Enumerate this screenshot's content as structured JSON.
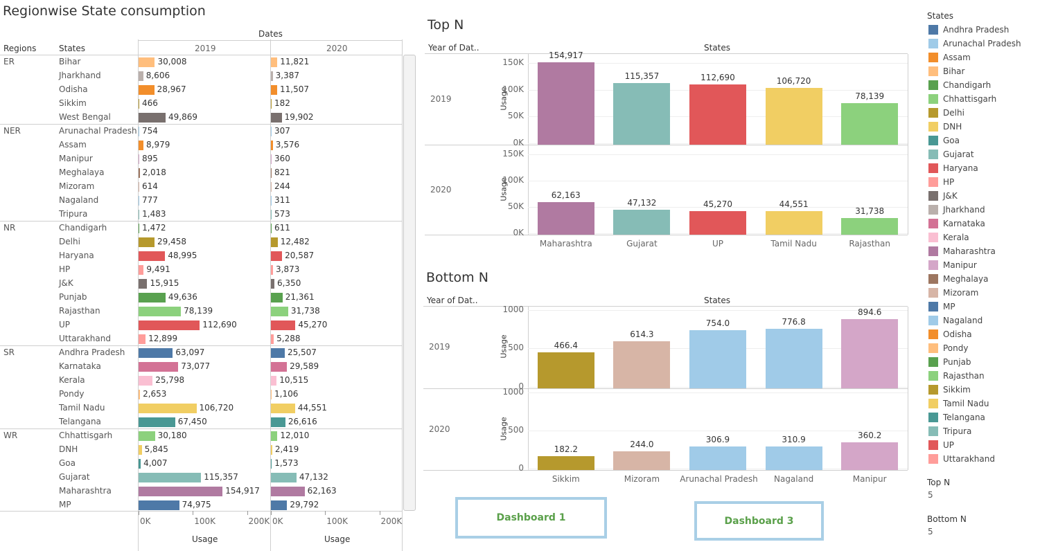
{
  "colors": {
    "Andhra Pradesh": "#4e79a7",
    "Arunachal Pradesh": "#a0cbe8",
    "Assam": "#f28e2b",
    "Bihar": "#ffbe7d",
    "Chandigarh": "#59a14f",
    "Chhattisgarh": "#8cd17d",
    "Delhi": "#b6992d",
    "DNH": "#f1ce63",
    "Goa": "#499894",
    "Gujarat": "#86bcb6",
    "Haryana": "#e15759",
    "HP": "#ff9d9a",
    "J&K": "#79706e",
    "Jharkhand": "#bab0ac",
    "Karnataka": "#d37295",
    "Kerala": "#fabfd2",
    "Maharashtra": "#b07aa1",
    "Manipur": "#d4a6c8",
    "Meghalaya": "#9d7660",
    "Mizoram": "#d7b5a6",
    "MP": "#4e79a7",
    "Nagaland": "#a0cbe8",
    "Odisha": "#f28e2b",
    "Pondy": "#ffbe7d",
    "Punjab": "#59a14f",
    "Rajasthan": "#8cd17d",
    "Sikkim": "#b6992d",
    "Tamil Nadu": "#f1ce63",
    "Telangana": "#499894",
    "Tripura": "#86bcb6",
    "UP": "#e15759",
    "Uttarakhand": "#ff9d9a",
    "West Bengal": "#79706e"
  },
  "left": {
    "title": "Regionwise State consumption",
    "dates_header": "Dates",
    "regions_header": "Regions",
    "states_header": "States",
    "col_2019": "2019",
    "col_2020": "2020",
    "axis_ticks": [
      "0K",
      "100K",
      "200K"
    ],
    "axis_title": "Usage",
    "rows": [
      {
        "region": "ER",
        "state": "Bihar",
        "v2019": 30008,
        "l2019": "30,008",
        "v2020": 11821,
        "l2020": "11,821"
      },
      {
        "region": "",
        "state": "Jharkhand",
        "v2019": 8606,
        "l2019": "8,606",
        "v2020": 3387,
        "l2020": "3,387"
      },
      {
        "region": "",
        "state": "Odisha",
        "v2019": 28967,
        "l2019": "28,967",
        "v2020": 11507,
        "l2020": "11,507"
      },
      {
        "region": "",
        "state": "Sikkim",
        "v2019": 466,
        "l2019": "466",
        "v2020": 182,
        "l2020": "182"
      },
      {
        "region": "",
        "state": "West Bengal",
        "v2019": 49869,
        "l2019": "49,869",
        "v2020": 19902,
        "l2020": "19,902"
      },
      {
        "region": "NER",
        "state": "Arunachal Pradesh",
        "v2019": 754,
        "l2019": "754",
        "v2020": 307,
        "l2020": "307"
      },
      {
        "region": "",
        "state": "Assam",
        "v2019": 8979,
        "l2019": "8,979",
        "v2020": 3576,
        "l2020": "3,576"
      },
      {
        "region": "",
        "state": "Manipur",
        "v2019": 895,
        "l2019": "895",
        "v2020": 360,
        "l2020": "360"
      },
      {
        "region": "",
        "state": "Meghalaya",
        "v2019": 2018,
        "l2019": "2,018",
        "v2020": 821,
        "l2020": "821"
      },
      {
        "region": "",
        "state": "Mizoram",
        "v2019": 614,
        "l2019": "614",
        "v2020": 244,
        "l2020": "244"
      },
      {
        "region": "",
        "state": "Nagaland",
        "v2019": 777,
        "l2019": "777",
        "v2020": 311,
        "l2020": "311"
      },
      {
        "region": "",
        "state": "Tripura",
        "v2019": 1483,
        "l2019": "1,483",
        "v2020": 573,
        "l2020": "573"
      },
      {
        "region": "NR",
        "state": "Chandigarh",
        "v2019": 1472,
        "l2019": "1,472",
        "v2020": 611,
        "l2020": "611"
      },
      {
        "region": "",
        "state": "Delhi",
        "v2019": 29458,
        "l2019": "29,458",
        "v2020": 12482,
        "l2020": "12,482"
      },
      {
        "region": "",
        "state": "Haryana",
        "v2019": 48995,
        "l2019": "48,995",
        "v2020": 20587,
        "l2020": "20,587"
      },
      {
        "region": "",
        "state": "HP",
        "v2019": 9491,
        "l2019": "9,491",
        "v2020": 3873,
        "l2020": "3,873"
      },
      {
        "region": "",
        "state": "J&K",
        "v2019": 15915,
        "l2019": "15,915",
        "v2020": 6350,
        "l2020": "6,350"
      },
      {
        "region": "",
        "state": "Punjab",
        "v2019": 49636,
        "l2019": "49,636",
        "v2020": 21361,
        "l2020": "21,361"
      },
      {
        "region": "",
        "state": "Rajasthan",
        "v2019": 78139,
        "l2019": "78,139",
        "v2020": 31738,
        "l2020": "31,738"
      },
      {
        "region": "",
        "state": "UP",
        "v2019": 112690,
        "l2019": "112,690",
        "v2020": 45270,
        "l2020": "45,270"
      },
      {
        "region": "",
        "state": "Uttarakhand",
        "v2019": 12899,
        "l2019": "12,899",
        "v2020": 5288,
        "l2020": "5,288"
      },
      {
        "region": "SR",
        "state": "Andhra Pradesh",
        "v2019": 63097,
        "l2019": "63,097",
        "v2020": 25507,
        "l2020": "25,507"
      },
      {
        "region": "",
        "state": "Karnataka",
        "v2019": 73077,
        "l2019": "73,077",
        "v2020": 29589,
        "l2020": "29,589"
      },
      {
        "region": "",
        "state": "Kerala",
        "v2019": 25798,
        "l2019": "25,798",
        "v2020": 10515,
        "l2020": "10,515"
      },
      {
        "region": "",
        "state": "Pondy",
        "v2019": 2653,
        "l2019": "2,653",
        "v2020": 1106,
        "l2020": "1,106"
      },
      {
        "region": "",
        "state": "Tamil Nadu",
        "v2019": 106720,
        "l2019": "106,720",
        "v2020": 44551,
        "l2020": "44,551"
      },
      {
        "region": "",
        "state": "Telangana",
        "v2019": 67450,
        "l2019": "67,450",
        "v2020": 26616,
        "l2020": "26,616"
      },
      {
        "region": "WR",
        "state": "Chhattisgarh",
        "v2019": 30180,
        "l2019": "30,180",
        "v2020": 12010,
        "l2020": "12,010"
      },
      {
        "region": "",
        "state": "DNH",
        "v2019": 5845,
        "l2019": "5,845",
        "v2020": 2419,
        "l2020": "2,419"
      },
      {
        "region": "",
        "state": "Goa",
        "v2019": 4007,
        "l2019": "4,007",
        "v2020": 1573,
        "l2020": "1,573"
      },
      {
        "region": "",
        "state": "Gujarat",
        "v2019": 115357,
        "l2019": "115,357",
        "v2020": 47132,
        "l2020": "47,132"
      },
      {
        "region": "",
        "state": "Maharashtra",
        "v2019": 154917,
        "l2019": "154,917",
        "v2020": 62163,
        "l2020": "62,163"
      },
      {
        "region": "",
        "state": "MP",
        "v2019": 74975,
        "l2019": "74,975",
        "v2020": 29792,
        "l2020": "29,792"
      }
    ]
  },
  "top_n": {
    "title": "Top N",
    "year_header": "Year of Dat..",
    "states_header": "States",
    "y_title": "Usage",
    "y_ticks": [
      "150K",
      "100K",
      "50K",
      "0K"
    ],
    "years": [
      "2019",
      "2020"
    ],
    "states": [
      "Maharashtra",
      "Gujarat",
      "UP",
      "Tamil Nadu",
      "Rajasthan"
    ],
    "values": [
      [
        154917,
        115357,
        112690,
        106720,
        78139
      ],
      [
        62163,
        47132,
        45270,
        44551,
        31738
      ]
    ],
    "labels": [
      [
        "154,917",
        "115,357",
        "112,690",
        "106,720",
        "78,139"
      ],
      [
        "62,163",
        "47,132",
        "45,270",
        "44,551",
        "31,738"
      ]
    ]
  },
  "bottom_n": {
    "title": "Bottom N",
    "year_header": "Year of Dat..",
    "states_header": "States",
    "y_title": "Usage",
    "y_ticks": [
      "1000",
      "500",
      "0"
    ],
    "years": [
      "2019",
      "2020"
    ],
    "states": [
      "Sikkim",
      "Mizoram",
      "Arunachal Pradesh",
      "Nagaland",
      "Manipur"
    ],
    "values": [
      [
        466.4,
        614.3,
        754.0,
        776.8,
        894.6
      ],
      [
        182.2,
        244.0,
        306.9,
        310.9,
        360.2
      ]
    ],
    "labels": [
      [
        "466.4",
        "614.3",
        "754.0",
        "776.8",
        "894.6"
      ],
      [
        "182.2",
        "244.0",
        "306.9",
        "310.9",
        "360.2"
      ]
    ]
  },
  "chart_data": [
    {
      "type": "bar",
      "title": "Regionwise State consumption",
      "xlabel": "Usage",
      "categories": [
        "Bihar",
        "Jharkhand",
        "Odisha",
        "Sikkim",
        "West Bengal",
        "Arunachal Pradesh",
        "Assam",
        "Manipur",
        "Meghalaya",
        "Mizoram",
        "Nagaland",
        "Tripura",
        "Chandigarh",
        "Delhi",
        "Haryana",
        "HP",
        "J&K",
        "Punjab",
        "Rajasthan",
        "UP",
        "Uttarakhand",
        "Andhra Pradesh",
        "Karnataka",
        "Kerala",
        "Pondy",
        "Tamil Nadu",
        "Telangana",
        "Chhattisgarh",
        "DNH",
        "Goa",
        "Gujarat",
        "Maharashtra",
        "MP"
      ],
      "series": [
        {
          "name": "2019",
          "values": [
            30008,
            8606,
            28967,
            466,
            49869,
            754,
            8979,
            895,
            2018,
            614,
            777,
            1483,
            1472,
            29458,
            48995,
            9491,
            15915,
            49636,
            78139,
            112690,
            12899,
            63097,
            73077,
            25798,
            2653,
            106720,
            67450,
            30180,
            5845,
            4007,
            115357,
            154917,
            74975
          ]
        },
        {
          "name": "2020",
          "values": [
            11821,
            3387,
            11507,
            182,
            19902,
            307,
            3576,
            360,
            821,
            244,
            311,
            573,
            611,
            12482,
            20587,
            3873,
            6350,
            21361,
            31738,
            45270,
            5288,
            25507,
            29589,
            10515,
            1106,
            44551,
            26616,
            12010,
            2419,
            1573,
            47132,
            62163,
            29792
          ]
        }
      ],
      "xlim": [
        0,
        230000
      ]
    },
    {
      "type": "bar",
      "title": "Top N",
      "ylabel": "Usage",
      "categories": [
        "Maharashtra",
        "Gujarat",
        "UP",
        "Tamil Nadu",
        "Rajasthan"
      ],
      "series": [
        {
          "name": "2019",
          "values": [
            154917,
            115357,
            112690,
            106720,
            78139
          ]
        },
        {
          "name": "2020",
          "values": [
            62163,
            47132,
            45270,
            44551,
            31738
          ]
        }
      ],
      "ylim": [
        0,
        170000
      ]
    },
    {
      "type": "bar",
      "title": "Bottom N",
      "ylabel": "Usage",
      "categories": [
        "Sikkim",
        "Mizoram",
        "Arunachal Pradesh",
        "Nagaland",
        "Manipur"
      ],
      "series": [
        {
          "name": "2019",
          "values": [
            466.4,
            614.3,
            754.0,
            776.8,
            894.6
          ]
        },
        {
          "name": "2020",
          "values": [
            182.2,
            244.0,
            306.9,
            310.9,
            360.2
          ]
        }
      ],
      "ylim": [
        0,
        1000
      ]
    }
  ],
  "legend": {
    "title": "States",
    "items": [
      "Andhra Pradesh",
      "Arunachal Pradesh",
      "Assam",
      "Bihar",
      "Chandigarh",
      "Chhattisgarh",
      "Delhi",
      "DNH",
      "Goa",
      "Gujarat",
      "Haryana",
      "HP",
      "J&K",
      "Jharkhand",
      "Karnataka",
      "Kerala",
      "Maharashtra",
      "Manipur",
      "Meghalaya",
      "Mizoram",
      "MP",
      "Nagaland",
      "Odisha",
      "Pondy",
      "Punjab",
      "Rajasthan",
      "Sikkim",
      "Tamil Nadu",
      "Telangana",
      "Tripura",
      "UP",
      "Uttarakhand"
    ]
  },
  "params": {
    "top_n_label": "Top N",
    "top_n_value": "5",
    "bottom_n_label": "Bottom N",
    "bottom_n_value": "5"
  },
  "buttons": {
    "dashboard1": "Dashboard 1",
    "dashboard3": "Dashboard 3"
  }
}
